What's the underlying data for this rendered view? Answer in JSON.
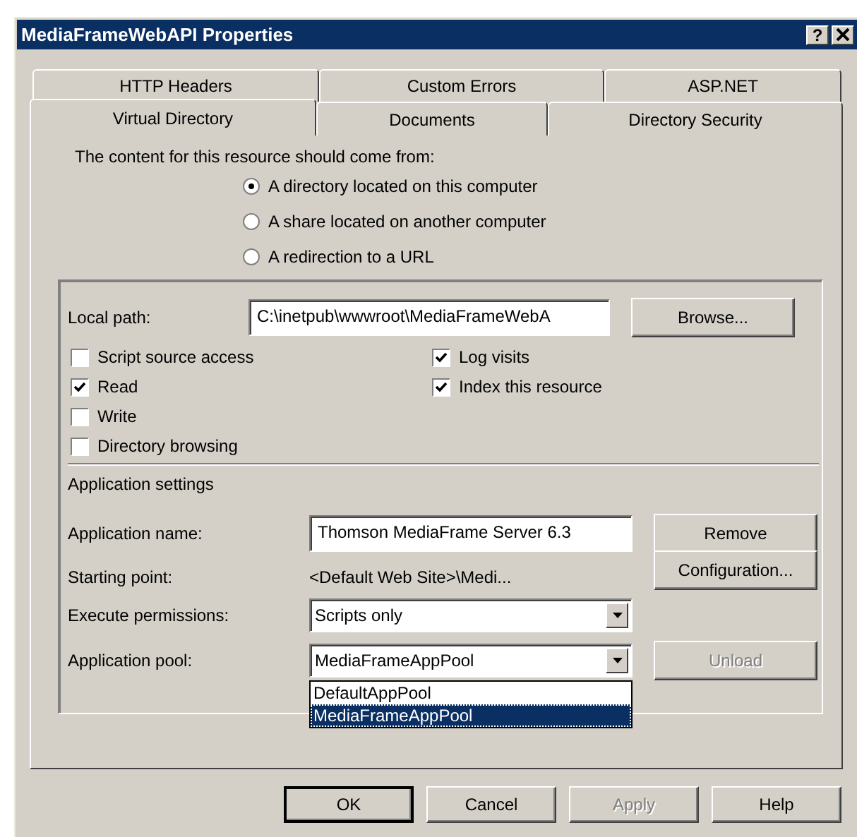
{
  "window": {
    "title": "MediaFrameWebAPI Properties",
    "help_button": "?"
  },
  "tab_rows": [
    [
      {
        "label": "HTTP Headers",
        "selected": false
      },
      {
        "label": "Custom Errors",
        "selected": false
      },
      {
        "label": "ASP.NET",
        "selected": false
      }
    ],
    [
      {
        "label": "Virtual Directory",
        "selected": true
      },
      {
        "label": "Documents",
        "selected": false
      },
      {
        "label": "Directory Security",
        "selected": false
      }
    ]
  ],
  "content_source": {
    "label": "The content for this resource should come from:",
    "options": [
      {
        "label": "A directory located on this computer",
        "selected": true
      },
      {
        "label": "A share located on another computer",
        "selected": false
      },
      {
        "label": "A redirection to a URL",
        "selected": false
      }
    ]
  },
  "local_path": {
    "label": "Local path:",
    "value": "C:\\inetpub\\wwwroot\\MediaFrameWebA",
    "button": "Browse..."
  },
  "permissions_left": [
    {
      "label": "Script source access",
      "checked": false
    },
    {
      "label": "Read",
      "checked": true
    },
    {
      "label": "Write",
      "checked": false
    },
    {
      "label": "Directory browsing",
      "checked": false
    }
  ],
  "permissions_right": [
    {
      "label": "Log visits",
      "checked": true
    },
    {
      "label": "Index this resource",
      "checked": true
    }
  ],
  "application_settings": {
    "heading": "Application settings",
    "name": {
      "label": "Application name:",
      "value": "Thomson MediaFrame Server 6.3",
      "button": "Remove"
    },
    "starting_point": {
      "label": "Starting point:",
      "value": "<Default Web Site>\\Medi..."
    },
    "configuration_button": "Configuration...",
    "execute_permissions": {
      "label": "Execute permissions:",
      "value": "Scripts only"
    },
    "application_pool": {
      "label": "Application pool:",
      "value": "MediaFrameAppPool",
      "options": [
        {
          "label": "DefaultAppPool",
          "selected": false
        },
        {
          "label": "MediaFrameAppPool",
          "selected": true
        }
      ]
    },
    "unload_button": {
      "label": "Unload",
      "disabled": true
    }
  },
  "buttons": [
    {
      "label": "OK",
      "disabled": false,
      "default": true
    },
    {
      "label": "Cancel",
      "disabled": false,
      "default": false
    },
    {
      "label": "Apply",
      "disabled": true,
      "default": false
    },
    {
      "label": "Help",
      "disabled": false,
      "default": false
    }
  ]
}
